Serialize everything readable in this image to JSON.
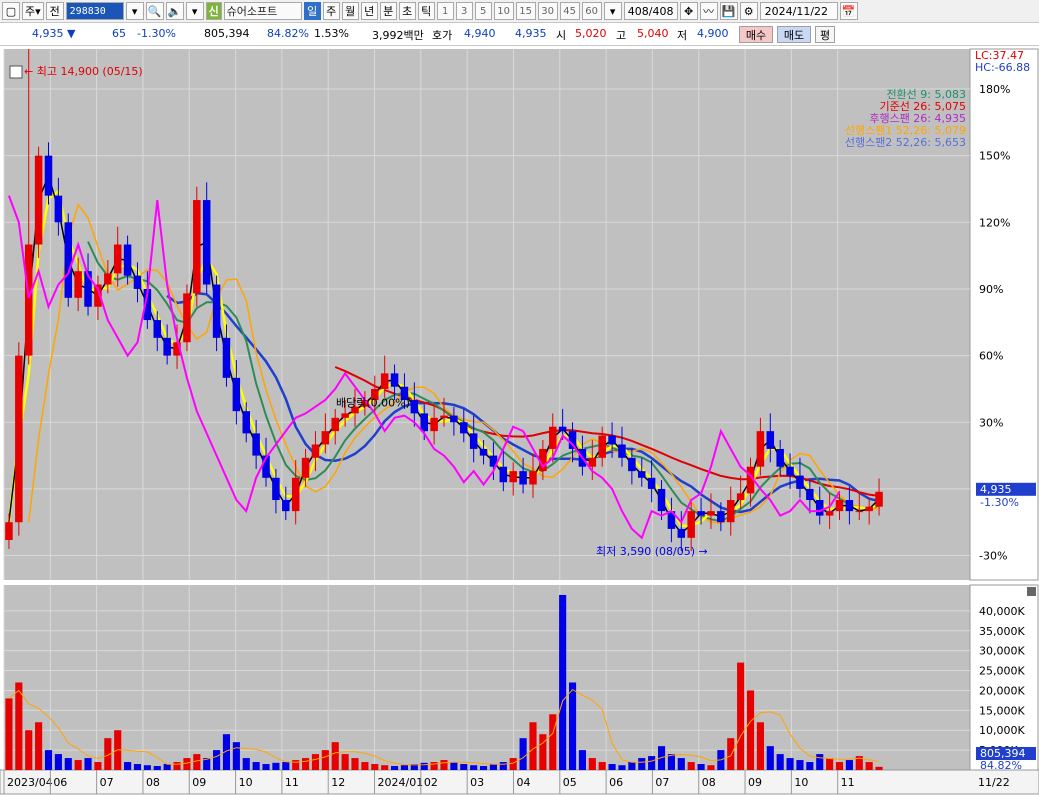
{
  "colors": {
    "up": "#e60000",
    "down": "#0000e6",
    "bg": "#c0c0c0",
    "frame": "#ffffff",
    "grid": "#d9d9d9",
    "conv": "#000000",
    "base": "#ffff00",
    "lag": "#ff00ff",
    "spanA": "#ffa500",
    "spanB": "#1f3fcc",
    "ma26": "#2e8b57",
    "ma52": "#e00000"
  },
  "toolbar": {
    "menu_icon": "window-icon",
    "market": "주",
    "chevron1": "▾",
    "prev": "전",
    "code": "298830",
    "chevron2": "▾",
    "search_icon": "🔍",
    "speaker_icon": "🔈",
    "chevron3": "▾",
    "credit_tag": "신",
    "name": "슈어소프트",
    "periods": [
      "일",
      "주",
      "월",
      "년",
      "분",
      "초",
      "틱"
    ],
    "numbers": [
      "1",
      "3",
      "5",
      "10",
      "15",
      "30",
      "45",
      "60"
    ],
    "chevron4": "▾",
    "count": "408/408",
    "tool_icons": [
      "✥",
      "〰",
      "💾",
      "⚙"
    ],
    "date": "2024/11/22",
    "calendar_icon": "📅"
  },
  "quote": {
    "price": "4,935",
    "arrow": "▼",
    "change": "65",
    "change_pct": "-1.30%",
    "volume": "805,394",
    "vol_ratio": "84.82%",
    "turnover": "1.53%",
    "amount": "3,992백만",
    "hoga_label": "호가",
    "ask": "4,940",
    "bid": "4,935",
    "open_label": "시",
    "open": "5,020",
    "high_label": "고",
    "high": "5,040",
    "low_label": "저",
    "low": "4,900",
    "buy": "매수",
    "sell": "매도",
    "avg": "평"
  },
  "price_panel": {
    "lc": "LC:37.47",
    "hc": "HC:-66.88",
    "legend": [
      {
        "label": "전환선 9: 5,083",
        "color": "#1f8f6f"
      },
      {
        "label": "기준선 26: 5,075",
        "color": "#e00000"
      },
      {
        "label": "후행스팬 26: 4,935",
        "color": "#b02cc0"
      },
      {
        "label": "선행스팬1 52,26: 5,079",
        "color": "#ffa500"
      },
      {
        "label": "선행스팬2 52,26: 5,653",
        "color": "#5a6fd6"
      }
    ],
    "high_note": "최고 14,900 (05/15)",
    "low_note": "최저 3,590 (08/05)",
    "dividend_note": "배당락(0.00%)",
    "price_box": "4,935",
    "pct_box": "-1.30%",
    "y_ticks": [
      "180%",
      "150%",
      "120%",
      "90%",
      "60%",
      "30%",
      "0%",
      "-30%"
    ],
    "x_labels": [
      "2023/04",
      "06",
      "07",
      "08",
      "09",
      "10",
      "11",
      "12",
      "2024/01",
      "02",
      "03",
      "04",
      "05",
      "06",
      "07",
      "08",
      "09",
      "10",
      "11"
    ],
    "last_date": "11/22"
  },
  "volume_panel": {
    "y_ticks": [
      "40,000K",
      "35,000K",
      "30,000K",
      "25,000K",
      "20,000K",
      "15,000K",
      "10,000K",
      "5,000K"
    ],
    "vol_box": "805,394",
    "pct_box": "84.82%"
  },
  "chart_data": {
    "type": "candlestick",
    "base_price": 5000,
    "price_ylim_pct": [
      -41,
      198
    ],
    "volume_ylim_k": [
      0,
      45000
    ],
    "months": [
      "2023/04",
      "06",
      "07",
      "08",
      "09",
      "10",
      "11",
      "12",
      "2024/01",
      "02",
      "03",
      "04",
      "05",
      "06",
      "07",
      "08",
      "09",
      "10",
      "11"
    ],
    "close_pct": [
      -15,
      60,
      110,
      150,
      132,
      120,
      86,
      98,
      82,
      92,
      97,
      110,
      96,
      90,
      76,
      68,
      60,
      66,
      88,
      130,
      92,
      68,
      50,
      35,
      25,
      15,
      5,
      -5,
      -10,
      5,
      14,
      20,
      26,
      32,
      34,
      37,
      40,
      45,
      52,
      46,
      40,
      34,
      26,
      32,
      33,
      30,
      25,
      18,
      15,
      10,
      3,
      8,
      2,
      8,
      18,
      28,
      26,
      18,
      10,
      14,
      24,
      20,
      14,
      8,
      5,
      0,
      -10,
      -18,
      -22,
      -10,
      -12,
      -10,
      -15,
      -5,
      -2,
      10,
      26,
      18,
      10,
      6,
      0,
      -5,
      -12,
      -10,
      -5,
      -10,
      -10,
      -8,
      -1.3
    ],
    "high_pct": 198,
    "low_pct": -28,
    "volume_k": [
      18000,
      22000,
      10000,
      12000,
      5000,
      4000,
      3000,
      2500,
      3000,
      2000,
      8000,
      10000,
      2000,
      1500,
      1200,
      1000,
      1500,
      2000,
      3000,
      4000,
      3000,
      5000,
      9000,
      7000,
      3000,
      2000,
      1500,
      1800,
      2000,
      2500,
      3000,
      4000,
      5000,
      7000,
      4000,
      3000,
      2000,
      1500,
      1200,
      1000,
      1200,
      1500,
      1800,
      2000,
      2500,
      2000,
      1500,
      1200,
      1000,
      1500,
      2000,
      3000,
      8000,
      12000,
      9000,
      14000,
      44000,
      22000,
      5000,
      3000,
      2000,
      1500,
      1200,
      2000,
      3000,
      3500,
      6000,
      4000,
      3000,
      2000,
      1500,
      1200,
      5000,
      8000,
      27000,
      20000,
      12000,
      6000,
      4000,
      3000,
      2500,
      2000,
      4000,
      3000,
      2000,
      2500,
      3500,
      2000,
      800
    ]
  }
}
